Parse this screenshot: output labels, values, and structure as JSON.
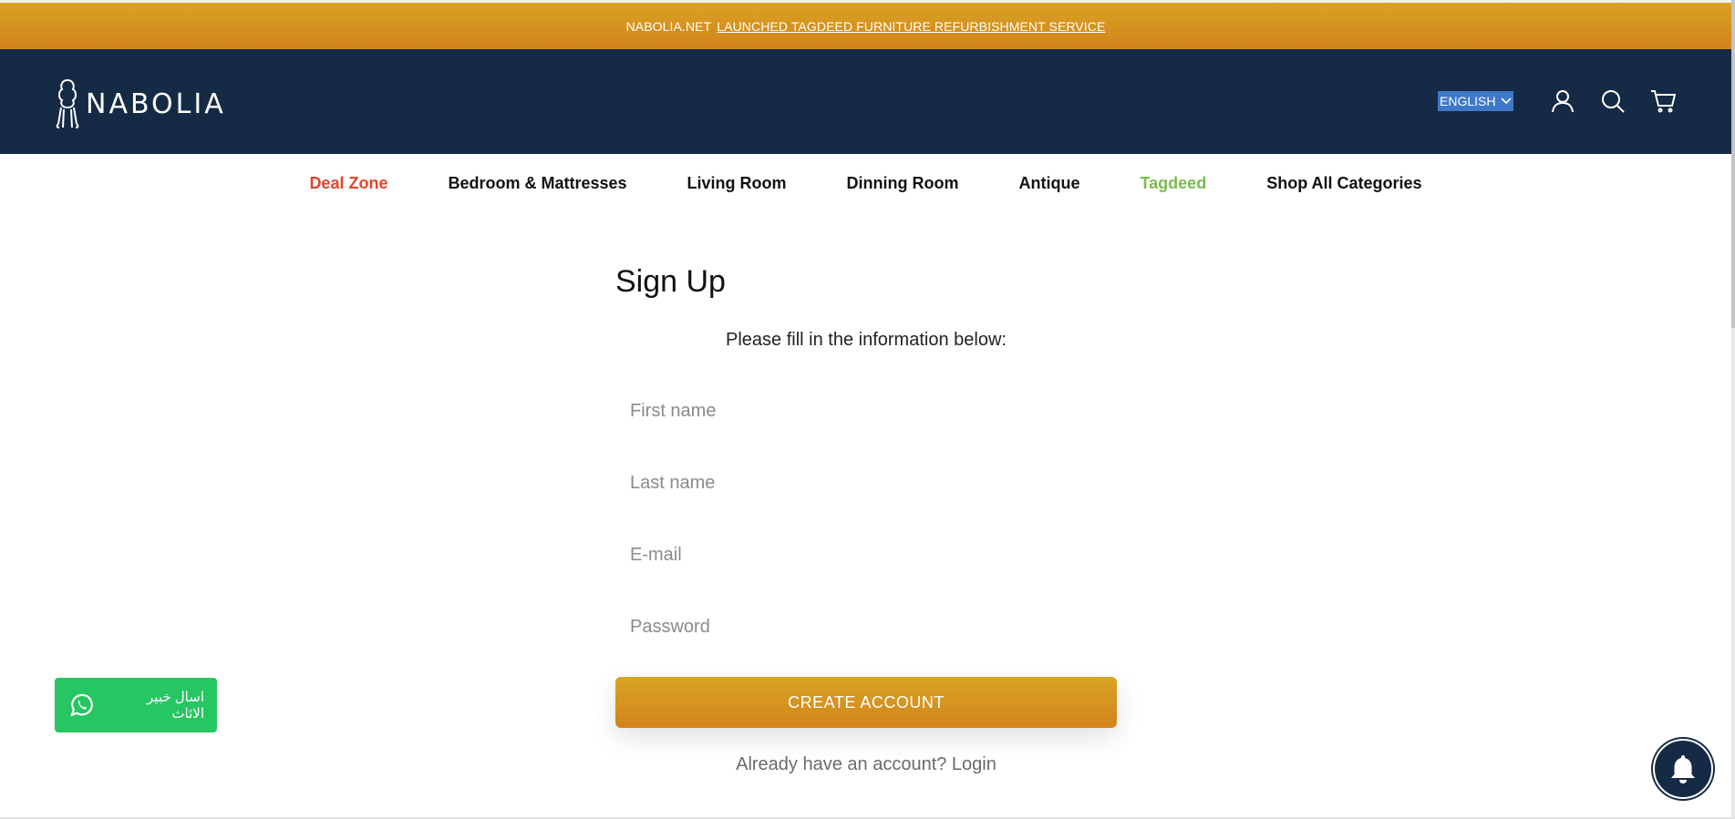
{
  "announcement": {
    "brand": "NABOLIA.NET",
    "link_text": " LAUNCHED TAGDEED  FURNITURE REFURBISHMENT SERVICE "
  },
  "header": {
    "logo_text": "NABOLIA",
    "language": "ENGLISH",
    "icons": [
      "account-icon",
      "search-icon",
      "cart-icon"
    ]
  },
  "nav": {
    "items": [
      "Deal Zone",
      "Bedroom & Mattresses",
      "Living Room",
      "Dinning Room",
      "Antique",
      "Tagdeed",
      "Shop All Categories"
    ]
  },
  "form": {
    "title": "Sign Up",
    "subtitle": "Please fill in the information below:",
    "first_name_placeholder": "First name",
    "last_name_placeholder": "Last name",
    "email_placeholder": "E-mail",
    "password_placeholder": "Password",
    "submit_label": "CREATE ACCOUNT",
    "login_prompt": "Already have an account? Login"
  },
  "whatsapp": {
    "label": "اسال خبير الاثاث"
  },
  "colors": {
    "header_bg": "#152a44",
    "accent_gold": "#d69a21",
    "deal_red": "#e5442a",
    "tagdeed_green": "#7cbb4f",
    "whatsapp_green": "#26c662"
  }
}
